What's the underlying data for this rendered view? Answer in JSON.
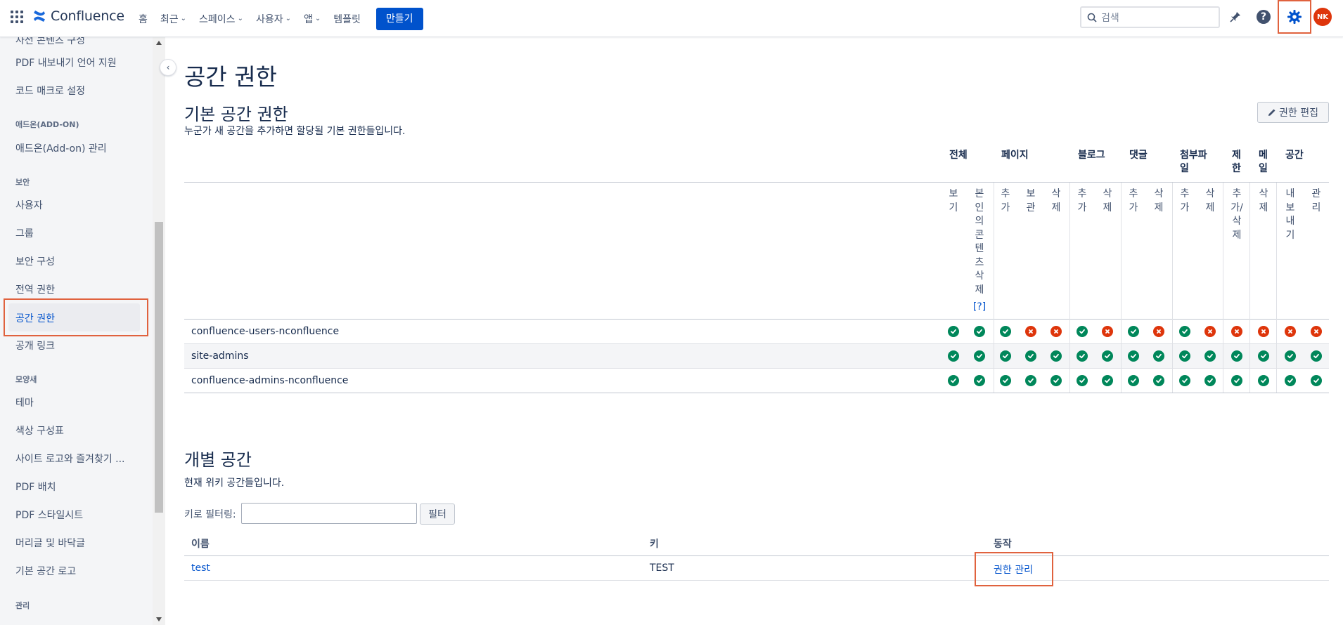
{
  "topbar": {
    "app_name": "Confluence",
    "nav": [
      {
        "label": "홈",
        "has_dropdown": false
      },
      {
        "label": "최근",
        "has_dropdown": true
      },
      {
        "label": "스페이스",
        "has_dropdown": true
      },
      {
        "label": "사용자",
        "has_dropdown": true
      },
      {
        "label": "앱",
        "has_dropdown": true
      },
      {
        "label": "템플릿",
        "has_dropdown": false
      }
    ],
    "create_label": "만들기",
    "search_placeholder": "검색",
    "avatar_initials": "NK",
    "icons": [
      "app-switcher-icon",
      "confluence-logo",
      "search-icon",
      "notification-icon",
      "help-icon",
      "settings-gear-icon"
    ]
  },
  "sidebar": {
    "items": [
      {
        "type": "item",
        "label": "PDF 내보내기 언어 지원"
      },
      {
        "type": "item",
        "label": "코드 매크로 설정"
      },
      {
        "type": "heading",
        "label": "애드온(ADD-ON)"
      },
      {
        "type": "item",
        "label": "애드온(Add-on) 관리"
      },
      {
        "type": "heading",
        "label": "보안"
      },
      {
        "type": "item",
        "label": "사용자"
      },
      {
        "type": "item",
        "label": "그룹"
      },
      {
        "type": "item",
        "label": "보안 구성"
      },
      {
        "type": "item",
        "label": "전역 권한"
      },
      {
        "type": "item",
        "label": "공간 권한",
        "active": true
      },
      {
        "type": "item",
        "label": "공개 링크"
      },
      {
        "type": "heading",
        "label": "모양새"
      },
      {
        "type": "item",
        "label": "테마"
      },
      {
        "type": "item",
        "label": "색상 구성표"
      },
      {
        "type": "item",
        "label": "사이트 로고와 즐겨찾기 ..."
      },
      {
        "type": "item",
        "label": "PDF 배치"
      },
      {
        "type": "item",
        "label": "PDF 스타일시트"
      },
      {
        "type": "item",
        "label": "머리글 및 바닥글"
      },
      {
        "type": "item",
        "label": "기본 공간 로고"
      },
      {
        "type": "heading",
        "label": "관리"
      }
    ]
  },
  "main": {
    "page_title": "공간 권한",
    "default_section": {
      "title": "기본 공간 권한",
      "description": "누군가 새 공간을 추가하면 할당될 기본 권한들입니다.",
      "edit_button": "권한 편집"
    },
    "permission_groups": [
      {
        "label": "전체",
        "cols": 2
      },
      {
        "label": "페이지",
        "cols": 3
      },
      {
        "label": "블로그",
        "cols": 2
      },
      {
        "label": "댓글",
        "cols": 2
      },
      {
        "label": "첨부파일",
        "cols": 2
      },
      {
        "label": "제한",
        "cols": 1
      },
      {
        "label": "메일",
        "cols": 1
      },
      {
        "label": "공간",
        "cols": 2
      }
    ],
    "permission_columns": [
      "보기",
      "본인의콘텐츠삭제",
      "추가",
      "보관",
      "삭제",
      "추가",
      "삭제",
      "추가",
      "삭제",
      "추가",
      "삭제",
      "추가/삭제",
      "삭제",
      "내보내기",
      "관리"
    ],
    "help_link": "[?]",
    "rows": [
      {
        "group": "confluence-users-nconfluence",
        "perms": [
          true,
          true,
          true,
          false,
          false,
          true,
          false,
          true,
          false,
          true,
          false,
          false,
          false,
          false,
          false
        ]
      },
      {
        "group": "site-admins",
        "perms": [
          true,
          true,
          true,
          true,
          true,
          true,
          true,
          true,
          true,
          true,
          true,
          true,
          true,
          true,
          true
        ]
      },
      {
        "group": "confluence-admins-nconfluence",
        "perms": [
          true,
          true,
          true,
          true,
          true,
          true,
          true,
          true,
          true,
          true,
          true,
          true,
          true,
          true,
          true
        ]
      }
    ],
    "individual_section": {
      "title": "개별 공간",
      "description": "현재 위키 공간들입니다.",
      "filter_label": "키로 필터링:",
      "filter_value": "",
      "filter_button": "필터",
      "columns": [
        "이름",
        "키",
        "동작"
      ],
      "spaces": [
        {
          "name": "test",
          "key": "TEST",
          "action": "권한 관리"
        }
      ]
    }
  },
  "colors": {
    "brand": "#0052cc",
    "granted": "#00875a",
    "denied": "#de350b",
    "highlight": "#e0623e"
  }
}
